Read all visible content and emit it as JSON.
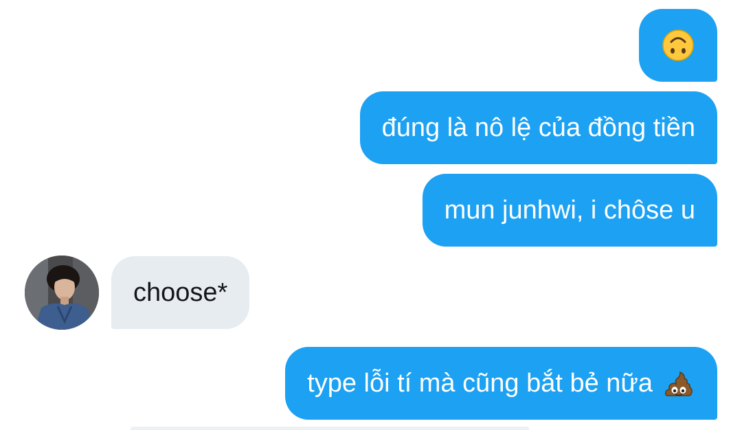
{
  "conversation": {
    "messages": [
      {
        "sender": "me",
        "text": "🙃",
        "emoji": "upside-down-face"
      },
      {
        "sender": "me",
        "text": "đúng là nô lệ của đồng tiền"
      },
      {
        "sender": "me",
        "text": "mun junhwi, i chôse u"
      },
      {
        "sender": "other",
        "text": "choose*"
      },
      {
        "sender": "me",
        "text": "type lỗi tí mà cũng bắt bẻ nữa",
        "emoji": "pile-of-poo"
      }
    ]
  },
  "colors": {
    "sent_bubble": "#1da1f2",
    "received_bubble": "#e6ecf0",
    "sent_text": "#ffffff",
    "received_text": "#14171a"
  },
  "icons": {
    "avatar": "user-avatar-photo",
    "emoji_1": "upside-down-face-emoji",
    "emoji_2": "pile-of-poo-emoji"
  }
}
